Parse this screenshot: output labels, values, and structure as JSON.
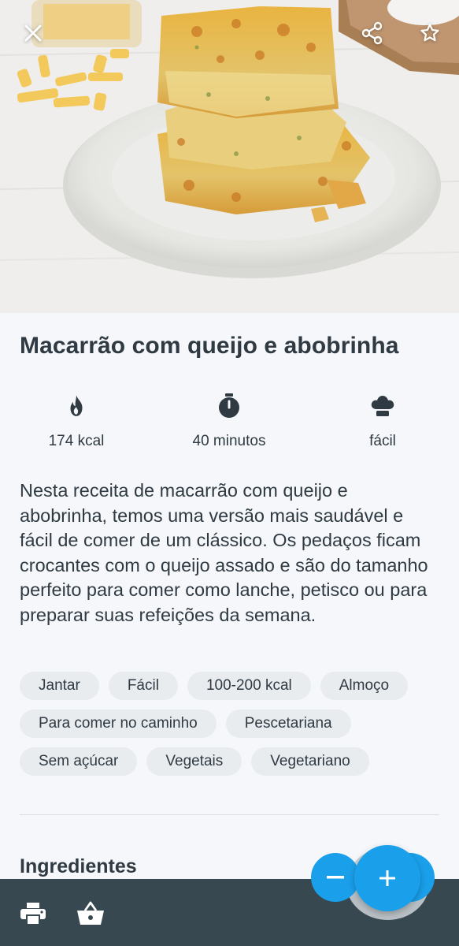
{
  "recipe": {
    "title": "Macarrão com queijo e abobrinha",
    "stats": {
      "calories": "174 kcal",
      "time": "40 minutos",
      "difficulty": "fácil"
    },
    "description": "Nesta receita de macarrão com queijo e abobrinha, temos uma versão mais saudável e fácil de comer de um clássico. Os pedaços ficam crocantes com o queijo assado e são do tamanho perfeito para comer como lanche, petisco ou para preparar suas refeições da semana.",
    "tags": [
      "Jantar",
      "Fácil",
      "100-200 kcal",
      "Almoço",
      "Para comer no caminho",
      "Pescetariana",
      "Sem açúcar",
      "Vegetais",
      "Vegetariano"
    ],
    "ingredients_heading": "Ingredientes"
  },
  "icons": {
    "close": "close-icon",
    "share": "share-icon",
    "favorite": "star-outline-icon",
    "calories": "flame-icon",
    "time": "stopwatch-icon",
    "difficulty": "chef-hat-icon",
    "print": "printer-icon",
    "shop": "basket-icon",
    "decrease": "minus-icon",
    "increase": "plus-icon"
  },
  "colors": {
    "accent": "#1a9fea",
    "bottom_bar": "#374850",
    "text": "#2f3a43",
    "chip": "#e9ecef",
    "background": "#f5f7fa"
  }
}
